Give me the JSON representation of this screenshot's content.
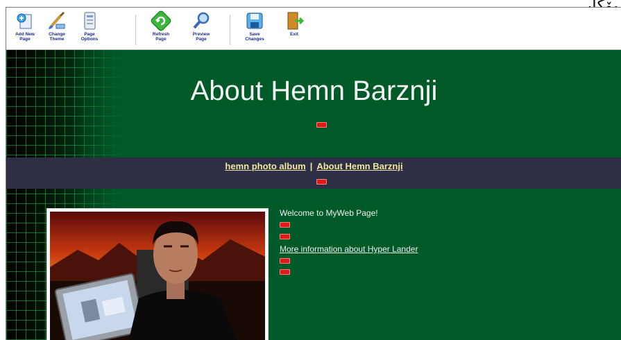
{
  "corner_text": "ﭘﯚﯕﺎﯨ",
  "toolbar": {
    "buttons": [
      {
        "label": "Add New\nPage",
        "icon": "add-page-icon"
      },
      {
        "label": "Change\nTheme",
        "icon": "change-theme-icon"
      },
      {
        "label": "Page\nOptions",
        "icon": "page-options-icon"
      },
      {
        "label": "Refresh\nPage",
        "icon": "refresh-icon"
      },
      {
        "label": "Preview\nPage",
        "icon": "preview-icon"
      },
      {
        "label": "Save\nChanges",
        "icon": "save-icon"
      },
      {
        "label": "Exit",
        "icon": "exit-icon"
      }
    ]
  },
  "page": {
    "title": "About Hemn Barznji",
    "nav": {
      "link1": "hemn photo album",
      "separator": "|",
      "link2": "About Hemn Barznji"
    },
    "welcome": "Welcome to MyWeb Page!",
    "more_info_link": "More information about Hyper Lander"
  },
  "colors": {
    "page_background": "#005a28",
    "navbar": "#2e2e44",
    "nav_link": "#f0e6a0",
    "edit_tag": "#e01818"
  }
}
